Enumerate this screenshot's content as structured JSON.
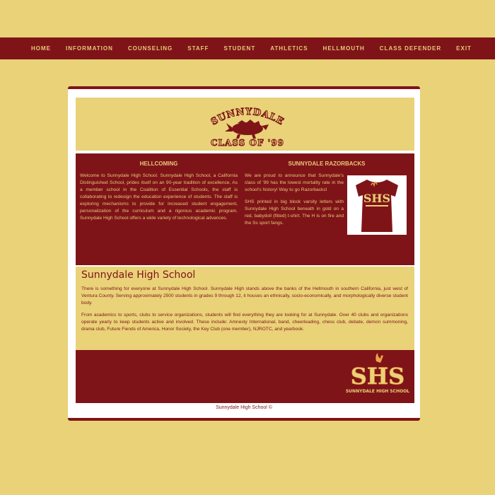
{
  "nav": {
    "items": [
      "HOME",
      "INFORMATION",
      "COUNSELING",
      "STAFF",
      "STUDENT",
      "ATHLETICS",
      "HELLMOUTH",
      "CLASS DEFENDER",
      "EXIT"
    ]
  },
  "banner": {
    "logo_top": "SUNNYDALE",
    "logo_bottom": "CLASS OF '99"
  },
  "hellcoming": {
    "title": "HELLCOMING",
    "body": "Welcome to Sunnydale High School. Sunnydale High School, a California Distinguished School, prides itself on an 90-year tradition of excellence. As a member school in the Coalition of Essential Schools, the staff is collaborating to redesign the education experience of students. The staff is exploring mechanisms to provide for increased student engagement, personalization of the curriculum and a rigorous academic program. Sunnydale High School offers a wide variety of technological advances."
  },
  "razorbacks": {
    "title": "SUNNYDALE RAZORBACKS",
    "p1": "We are proud to announce that Sunnydale's class of '99 has the lowest mortality rate in the school's history! Way to go Razorbacks!",
    "p2": "SHS printed in big block varsity letters with Sunnydale High School beneath in gold on a red, babydoll (fitted) t-shirt. The H is on fire and the Ss sport fangs.",
    "shirt_text": "SHS"
  },
  "about": {
    "title": "Sunnydale High School",
    "p1": "There is something for everyone at Sunnydale High School. Sunnydale High stands above the banks of the Hellmouth in southern California, just west of Ventura County. Serving approximately 2500 students in grades 9 through 12, it houses an ethnically, socio-economically, and morphologically diverse student body.",
    "p2": "From academics to sports, clubs to service organizations, students will find everything they are looking for at Sunnydale. Over 40 clubs and organizations operate yearly to keep students active and involved. These include: Amnesty International, band, cheerleading, chess club, debate, demon summoning, drama club, Future Fiends of America, Honor Society, the Key Club (one member), NJROTC, and yearbook."
  },
  "bottom_logo": {
    "letters": "SHS",
    "subtitle": "SUNNYDALE HIGH SCHOOL"
  },
  "footer": {
    "text": "Sunnydale High School ©"
  },
  "colors": {
    "maroon": "#7f1418",
    "gold": "#e9d278",
    "gold_text": "#e8c77a"
  }
}
